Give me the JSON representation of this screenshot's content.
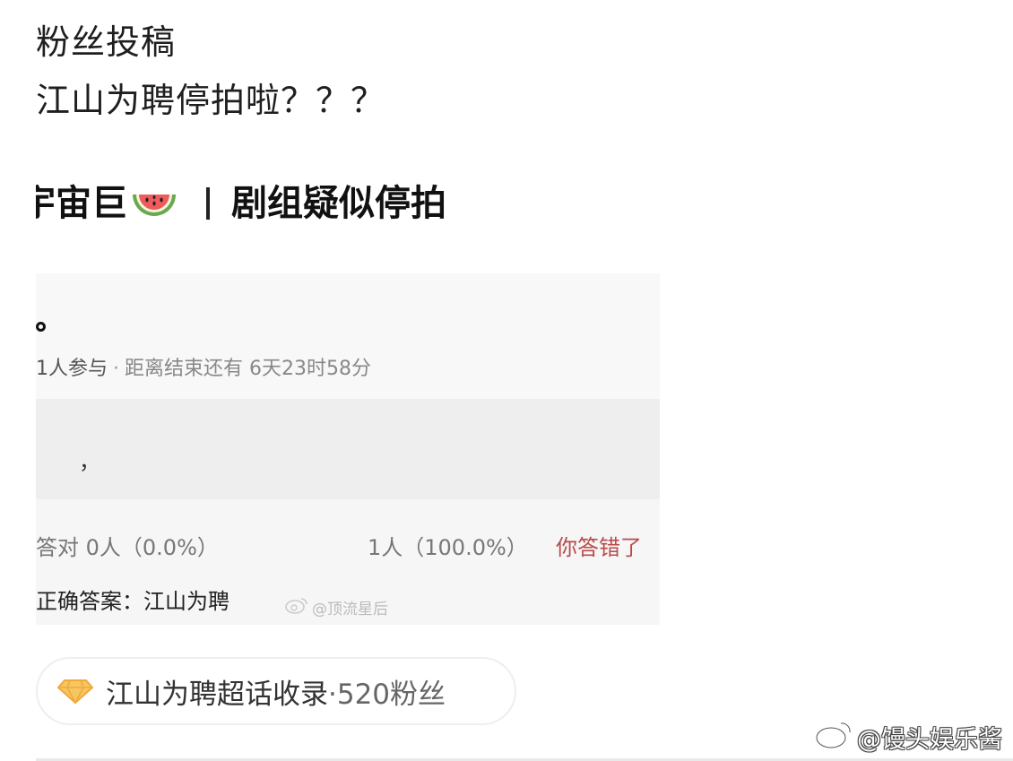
{
  "post": {
    "line1": "粉丝投稿",
    "line2": "江山为聘停拍啦？？？"
  },
  "headline": {
    "prefix": "宇宙巨",
    "emoji": "watermelon-icon",
    "suffix": "剧组疑似停拍"
  },
  "quiz": {
    "participants": "1人参与",
    "separator": "·",
    "countdown": "距离结束还有 6天23时58分",
    "option_text": "，",
    "correct_stat": "答对 0人（0.0%）",
    "other_stat": "1人（100.0%）",
    "result": "你答错了",
    "answer": "正确答案：江山为聘",
    "watermark": "@顶流星后"
  },
  "topic": {
    "icon": "diamond-icon",
    "name": "江山为聘超话收录",
    "dot": "·",
    "fans": "520粉丝"
  },
  "watermark": {
    "text": "@馒头娱乐酱",
    "icon": "weibo-icon"
  },
  "colors": {
    "accent_wrong": "#b94a4a",
    "diamond": "#f2a93b",
    "card_bg": "#f6f6f6"
  }
}
